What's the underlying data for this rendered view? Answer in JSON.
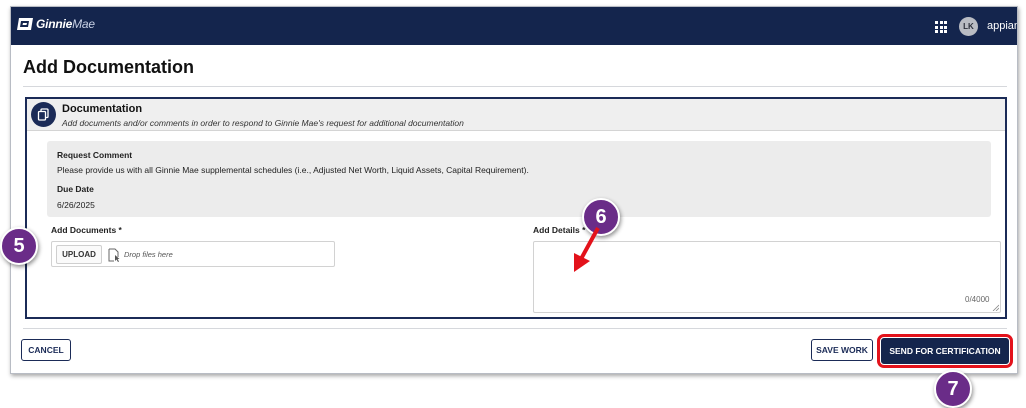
{
  "topbar": {
    "logo_bold": "Ginnie",
    "logo_light": "Mae",
    "avatar_initials": "LK",
    "brand": "appian",
    "bg_color": "#14254d"
  },
  "page": {
    "title": "Add Documentation"
  },
  "documentation": {
    "title": "Documentation",
    "subtitle": "Add documents and/or comments in order to respond to Ginnie Mae's request for additional documentation",
    "request_comment_label": "Request Comment",
    "request_comment_text": "Please provide us with all Ginnie Mae supplemental schedules (i.e., Adjusted Net Worth, Liquid Assets, Capital Requirement).",
    "due_date_label": "Due Date",
    "due_date_value": "6/26/2025"
  },
  "add_documents": {
    "label": "Add Documents *",
    "upload_label": "UPLOAD",
    "drop_placeholder": "Drop files here"
  },
  "add_details": {
    "label": "Add Details *",
    "value": "",
    "char_count": "0/4000"
  },
  "footer": {
    "cancel_label": "CANCEL",
    "save_label": "SAVE WORK",
    "send_label": "SEND FOR CERTIFICATION"
  },
  "step_markers": [
    "5",
    "6",
    "7"
  ],
  "colors": {
    "accent": "#6a2c88",
    "highlight": "#e3121b",
    "navy": "#1b2b57"
  }
}
